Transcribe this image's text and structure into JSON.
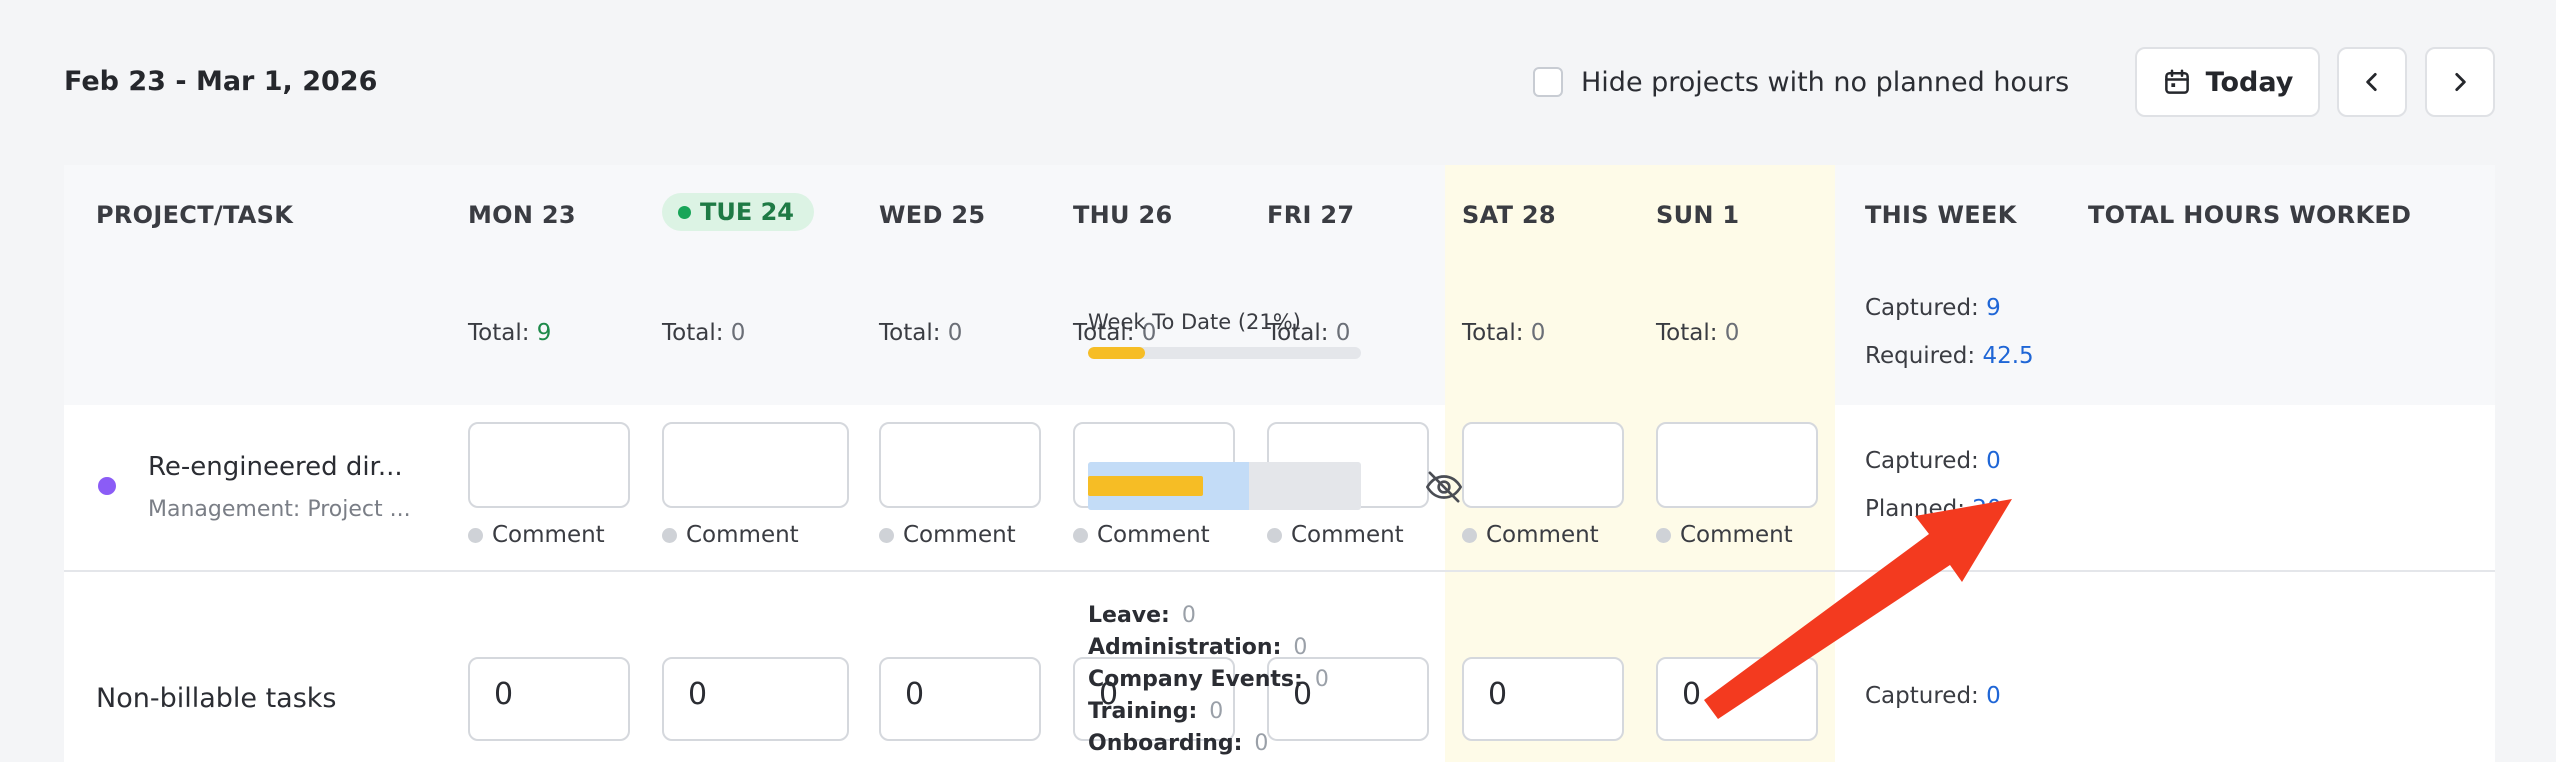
{
  "toolbar": {
    "date_range": "Feb 23 - Mar 1, 2026",
    "hide_label": "Hide projects with no planned hours",
    "today_label": "Today"
  },
  "header": {
    "project_task": "PROJECT/TASK",
    "days": [
      {
        "label": "MON 23",
        "total_label": "Total:",
        "total": "9",
        "is_today": false,
        "is_weekend": false
      },
      {
        "label": "TUE 24",
        "total_label": "Total:",
        "total": "0",
        "is_today": true,
        "is_weekend": false
      },
      {
        "label": "WED 25",
        "total_label": "Total:",
        "total": "0",
        "is_today": false,
        "is_weekend": false
      },
      {
        "label": "THU 26",
        "total_label": "Total:",
        "total": "0",
        "is_today": false,
        "is_weekend": false
      },
      {
        "label": "FRI 27",
        "total_label": "Total:",
        "total": "0",
        "is_today": false,
        "is_weekend": false
      },
      {
        "label": "SAT 28",
        "total_label": "Total:",
        "total": "0",
        "is_today": false,
        "is_weekend": true
      },
      {
        "label": "SUN 1",
        "total_label": "Total:",
        "total": "0",
        "is_today": false,
        "is_weekend": true
      }
    ],
    "this_week": "THIS WEEK",
    "total_hours_worked": "TOTAL HOURS WORKED",
    "captured_label": "Captured:",
    "captured_value": "9",
    "required_label": "Required:",
    "required_value": "42.5",
    "week_to_date_label": "Week To Date (21%)",
    "week_to_date_fraction": 0.21
  },
  "rows": {
    "project": {
      "name": "Re-engineered dir...",
      "subtitle": "Management: Project ...",
      "dot_color": "#8b5cf6",
      "comment_label": "Comment",
      "captured_label": "Captured:",
      "captured_value": "0",
      "planned_label": "Planned:",
      "planned_value": "20",
      "planned_bar_fraction": 0.59,
      "captured_bar_fraction": 0.42
    },
    "nonbillable": {
      "name": "Non-billable tasks",
      "values": [
        "0",
        "0",
        "0",
        "0",
        "0",
        "0",
        "0"
      ],
      "captured_label": "Captured:",
      "captured_value": "0",
      "categories": [
        {
          "label": "Leave:",
          "value": "0"
        },
        {
          "label": "Administration:",
          "value": "0"
        },
        {
          "label": "Company Events:",
          "value": "0"
        },
        {
          "label": "Training:",
          "value": "0"
        },
        {
          "label": "Onboarding:",
          "value": "0"
        }
      ]
    }
  },
  "colors": {
    "accent_blue": "#1f66d6",
    "today_green": "#18a558",
    "progress_yellow": "#f6bd25",
    "weekend_bg": "#fefbe8",
    "annotation_arrow": "#f33a1f"
  }
}
